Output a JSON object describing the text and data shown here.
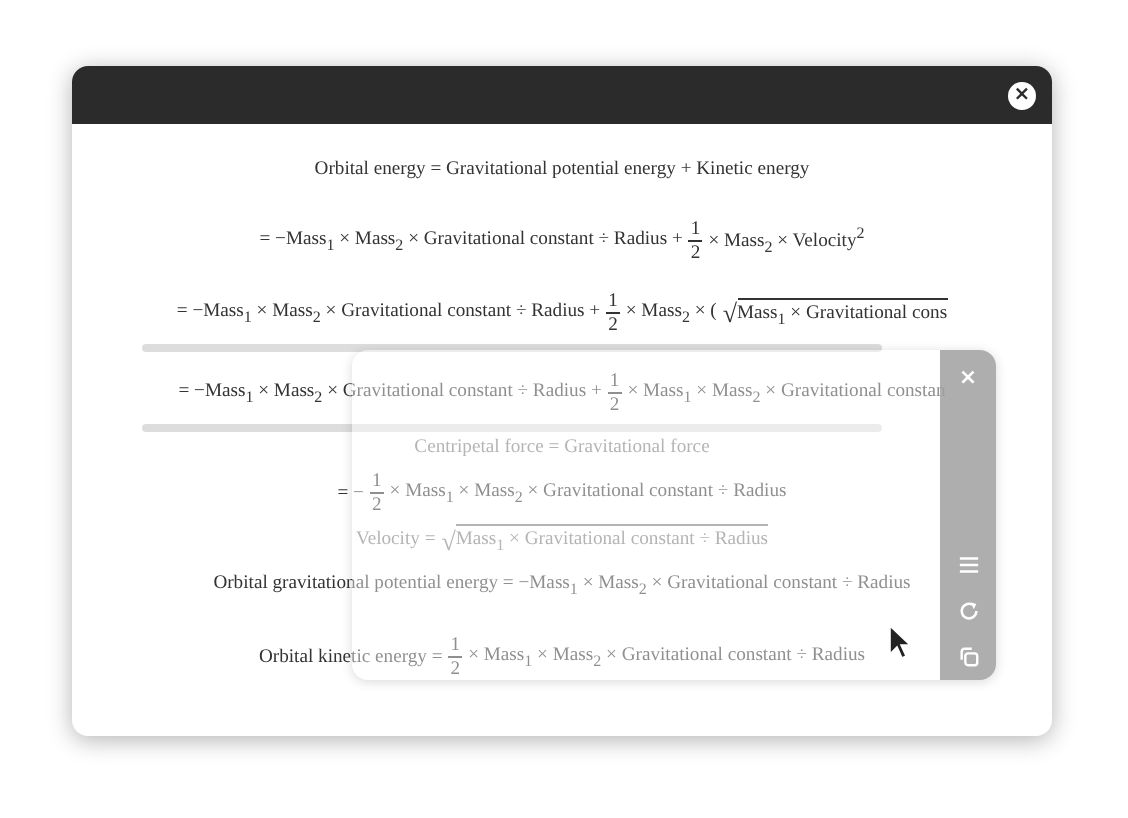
{
  "window": {
    "title_bar": {
      "close": "×"
    }
  },
  "equations": [
    {
      "faded": false,
      "scroll": false,
      "parts": [
        {
          "kind": "text",
          "s": "Orbital energy = Gravitational potential energy + Kinetic energy"
        }
      ]
    },
    {
      "faded": false,
      "scroll": false,
      "parts": [
        {
          "kind": "text",
          "s": "= −Mass$_{1}$ × Mass$_{2}$ × Gravitational constant ÷ Radius +"
        },
        {
          "kind": "frac",
          "num": "1",
          "den": "2"
        },
        {
          "kind": "text",
          "s": "× Mass$_{2}$ × Velocity$^{2}$"
        }
      ]
    },
    {
      "faded": false,
      "scroll": true,
      "parts": [
        {
          "kind": "text",
          "s": "= −Mass$_{1}$ × Mass$_{2}$ × Gravitational constant ÷ Radius +"
        },
        {
          "kind": "frac",
          "num": "1",
          "den": "2"
        },
        {
          "kind": "text",
          "s": "× Mass$_{2}$ × ("
        },
        {
          "kind": "sqrt",
          "sign": "√",
          "s": "Mass$_{1}$ × Gravitational cons"
        }
      ]
    },
    {
      "faded": false,
      "scroll": true,
      "parts": [
        {
          "kind": "text",
          "s": "= −Mass$_{1}$ × Mass$_{2}$ × Gravitational constant ÷ Radius +"
        },
        {
          "kind": "frac",
          "num": "1",
          "den": "2"
        },
        {
          "kind": "text",
          "s": "× Mass$_{1}$ × Mass$_{2}$ × Gravitational constan"
        }
      ]
    },
    {
      "faded": true,
      "scroll": false,
      "parts": [
        {
          "kind": "text",
          "s": "Centripetal force = Gravitational force"
        }
      ]
    },
    {
      "faded": false,
      "scroll": false,
      "parts": [
        {
          "kind": "text",
          "s": "= −"
        },
        {
          "kind": "frac",
          "num": "1",
          "den": "2"
        },
        {
          "kind": "text",
          "s": "× Mass$_{1}$ × Mass$_{2}$ × Gravitational constant ÷ Radius"
        }
      ]
    },
    {
      "faded": true,
      "scroll": false,
      "parts": [
        {
          "kind": "text",
          "s": "Velocity ="
        },
        {
          "kind": "sqrt",
          "sign": "√",
          "s": "Mass$_{1}$ × Gravitational constant ÷ Radius"
        }
      ]
    },
    {
      "faded": false,
      "scroll": false,
      "parts": [
        {
          "kind": "text",
          "s": "Orbital gravitational potential energy = −Mass$_{1}$ × Mass$_{2}$ × Gravitational constant ÷ Radius"
        }
      ]
    },
    {
      "faded": false,
      "scroll": false,
      "parts": [
        {
          "kind": "text",
          "s": "Orbital kinetic energy ="
        },
        {
          "kind": "frac",
          "num": "1",
          "den": "2"
        },
        {
          "kind": "text",
          "s": "× Mass$_{1}$ × Mass$_{2}$ × Gravitational constant ÷ Radius"
        }
      ]
    }
  ],
  "overlay": {
    "close": "×"
  }
}
